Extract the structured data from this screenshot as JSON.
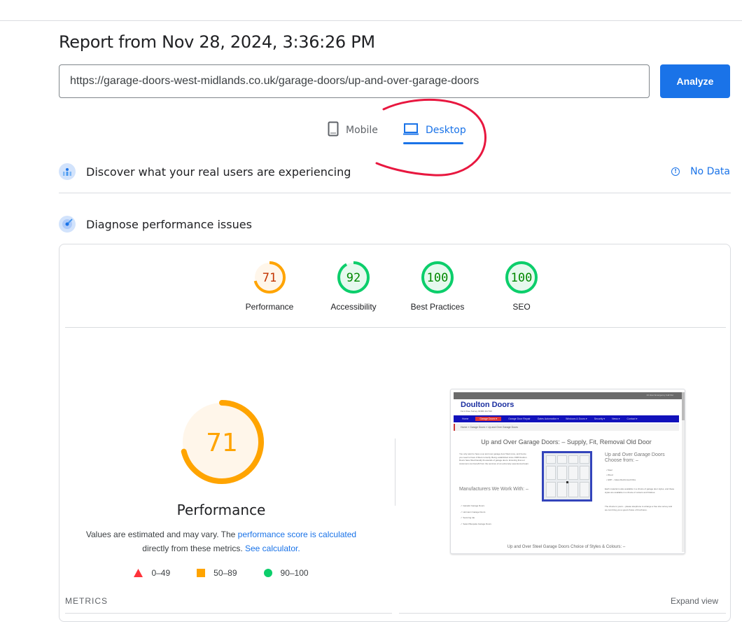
{
  "report": {
    "title": "Report from Nov 28, 2024, 3:36:26 PM",
    "url_value": "https://garage-doors-west-midlands.co.uk/garage-doors/up-and-over-garage-doors",
    "analyze_label": "Analyze"
  },
  "tabs": [
    {
      "label": "Mobile",
      "icon": "phone-icon",
      "active": false
    },
    {
      "label": "Desktop",
      "icon": "laptop-icon",
      "active": true
    }
  ],
  "sections": {
    "crux": {
      "label": "Discover what your real users are experiencing",
      "status": "No Data",
      "icon": "users-icon"
    },
    "diagnose": {
      "label": "Diagnose performance issues",
      "icon": "radar-icon"
    }
  },
  "scores": [
    {
      "label": "Performance",
      "value": 71,
      "color": "#ffa400",
      "text_color": "#c33300",
      "bg": "#fff6ea"
    },
    {
      "label": "Accessibility",
      "value": 92,
      "color": "#0cce6b",
      "text_color": "#008800",
      "bg": "#e6f9ee"
    },
    {
      "label": "Best Practices",
      "value": 100,
      "color": "#0cce6b",
      "text_color": "#008800",
      "bg": "#e6f9ee"
    },
    {
      "label": "SEO",
      "value": 100,
      "color": "#0cce6b",
      "text_color": "#008800",
      "bg": "#e6f9ee"
    }
  ],
  "performance": {
    "score": 71,
    "title": "Performance",
    "desc_prefix": "Values are estimated and may vary. The ",
    "desc_link1": "performance score is calculated",
    "desc_mid": " directly from these metrics. ",
    "desc_link2": "See calculator.",
    "legend": [
      {
        "range": "0–49",
        "shape": "triangle",
        "color": "#ff333a"
      },
      {
        "range": "50–89",
        "shape": "square",
        "color": "#ffa400"
      },
      {
        "range": "90–100",
        "shape": "circle",
        "color": "#0cce6b"
      }
    ]
  },
  "metrics": {
    "label": "METRICS",
    "expand_label": "Expand view"
  },
  "thumbnail": {
    "top_bar_text": "24 Hour Emergency Call Out",
    "brand": "Doulton Doors",
    "tagline": "For A Free Survey 01384 411 510",
    "nav": [
      "Home",
      "Garage Doors ▾",
      "Garage Door Repair",
      "Gates Automation ▾",
      "Windows & Doors ▾",
      "Security ▾",
      "News ▾",
      "Contact ▾"
    ],
    "breadcrumb": "Home » Garage Doors » Up and Over Garage Doors",
    "heading": "Up and Over Garage Doors: – Supply, Fit, Removal Old Door",
    "intro": "You only want to have a up and over garage door fitted once, and hence you need to have it fitted correctly. Being established since 1996 Doulton Doors have fitted literally thousands of garage doors. Ensuring that our customers can benefit from the services of an extremely experienced team.",
    "manufacturers_heading": "Manufacturers We Work With: –",
    "manufacturers": [
      "✓ Garador Garage Doors",
      "✓ Hormann Garage Doors",
      "✓ Securing Ide",
      "✓ Select Bespoke Garage Doors"
    ],
    "choose_heading": "Up and Over Garage Doors Choose from: –",
    "choose": [
      "• Steel",
      "• Wood",
      "• GRP – Glass Reinforced Fibre"
    ],
    "material_text": "Each material is also available in a choice of garage door styles, and these styles are available in a choice of colours and finishes.",
    "choice_text": "The choice is yours – please telephone to arrange a free site survey and we can bring you a good choice of brochures.",
    "footer_heading": "Up and Over Steel Garage Doors Choice of Styles & Colours: –"
  },
  "colors": {
    "accent": "#1a73e8",
    "annotation": "#e8173f",
    "average": "#ffa400",
    "pass": "#0cce6b",
    "fail": "#ff333a"
  }
}
